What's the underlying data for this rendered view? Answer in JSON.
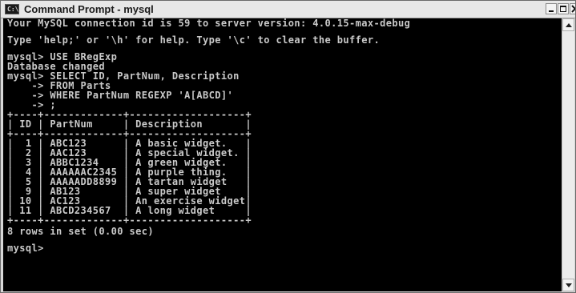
{
  "window": {
    "title": "Command Prompt - mysql",
    "icon_label": "C:\\"
  },
  "console": {
    "lines": [
      "Your MySQL connection id is 59 to server version: 4.0.15-max-debug",
      "",
      "Type 'help;' or '\\h' for help. Type '\\c' to clear the buffer.",
      "",
      "mysql> USE BRegExp",
      "Database changed",
      "mysql> SELECT ID, PartNum, Description",
      "    -> FROM Parts",
      "    -> WHERE PartNum REGEXP 'A[ABCD]'",
      "    -> ;",
      "+----+-------------+-------------------+",
      "| ID | PartNum     | Description       |",
      "+----+-------------+-------------------+",
      "|  1 | ABC123      | A basic widget.   |",
      "|  2 | AAC123      | A special widget. |",
      "|  3 | ABBC1234    | A green widget.   |",
      "|  4 | AAAAAAC2345 | A purple thing.   |",
      "|  5 | AAAAADD8899 | A tartan widget   |",
      "|  9 | AB123       | A super widget    |",
      "| 10 | AC123       | An exercise widget|",
      "| 11 | ABCD234567  | A long widget     |",
      "+----+-------------+-------------------+",
      "8 rows in set (0.00 sec)",
      "",
      "mysql>"
    ]
  },
  "colors": {
    "console_bg": "#000000",
    "console_fg": "#c9c9c9",
    "titlebar_bg": "#e7e7e7"
  },
  "icons": {
    "app": "command-prompt-icon",
    "minimize": "minimize-icon",
    "maximize": "maximize-icon",
    "close": "close-icon",
    "scroll_up": "scroll-up-arrow-icon",
    "scroll_down": "scroll-down-arrow-icon"
  }
}
